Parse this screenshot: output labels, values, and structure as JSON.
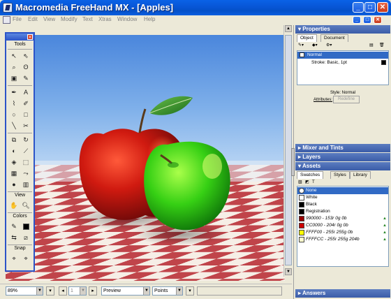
{
  "window": {
    "title": "Macromedia FreeHand MX - [Apples]"
  },
  "menu": [
    "File",
    "Edit",
    "View",
    "Modify",
    "Text",
    "Xtras",
    "Window",
    "Help"
  ],
  "tools": {
    "title": "Tools",
    "sections": [
      "View",
      "Colors",
      "Snap"
    ]
  },
  "status": {
    "zoom": "89%",
    "page": "1",
    "view_mode": "Preview",
    "units": "Points"
  },
  "properties": {
    "title": "Properties",
    "tabs": [
      "Object",
      "Document"
    ],
    "rows": [
      "Normal",
      "Stroke: Basic, 1pt"
    ],
    "style_label": "Style: Normal",
    "attributes_label": "Attributes:",
    "attributes_button": "Redefine"
  },
  "collapsed_panels": [
    "Mixer and Tints",
    "Layers"
  ],
  "assets": {
    "title": "Assets",
    "tabs": [
      "Swatches",
      "Styles",
      "Library"
    ],
    "swatches": [
      {
        "name": "None",
        "color": "#ffffff",
        "selected": true
      },
      {
        "name": "White",
        "color": "#ffffff"
      },
      {
        "name": "Black",
        "color": "#000000"
      },
      {
        "name": "Registration",
        "color": "#000000"
      },
      {
        "name": "990000 - 153r 0g 0b",
        "color": "#990000",
        "process": true
      },
      {
        "name": "CC0000 - 204r 0g 0b",
        "color": "#cc0000",
        "process": true
      },
      {
        "name": "FFFF00 - 255r 255g 0b",
        "color": "#ffff00",
        "process": true
      },
      {
        "name": "FFFFCC - 255r 255g 204b",
        "color": "#ffffcc",
        "process": true
      }
    ]
  },
  "answers": {
    "title": "Answers"
  }
}
